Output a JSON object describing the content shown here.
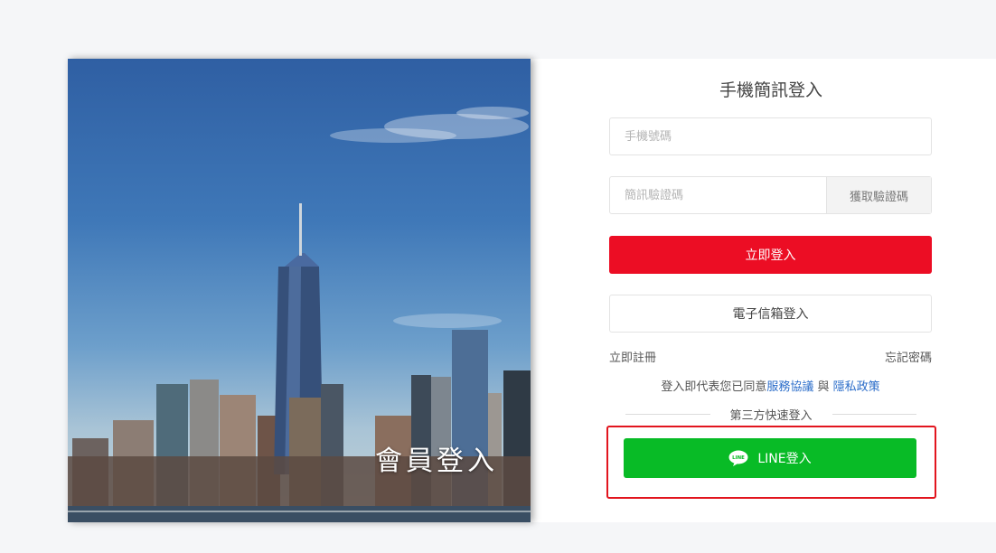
{
  "hero": {
    "caption": "會員登入"
  },
  "form": {
    "title": "手機簡訊登入",
    "phone_placeholder": "手機號碼",
    "sms_placeholder": "簡訊驗證碼",
    "get_code_label": "獲取驗證碼",
    "login_label": "立即登入",
    "email_login_label": "電子信箱登入",
    "register_label": "立即註冊",
    "forgot_label": "忘記密碼",
    "agree_prefix": "登入即代表您已同意",
    "terms_label": "服務協議",
    "agree_and": "與",
    "privacy_label": "隱私政策",
    "third_party_label": "第三方快速登入",
    "line_login_label": "LINE登入",
    "line_icon_text": "LINE"
  },
  "colors": {
    "primary_red": "#ec0d24",
    "line_green": "#08bb26",
    "link_blue": "#2a6cc9",
    "highlight_red": "#e2151e"
  },
  "icons": {
    "line": "line-icon"
  }
}
